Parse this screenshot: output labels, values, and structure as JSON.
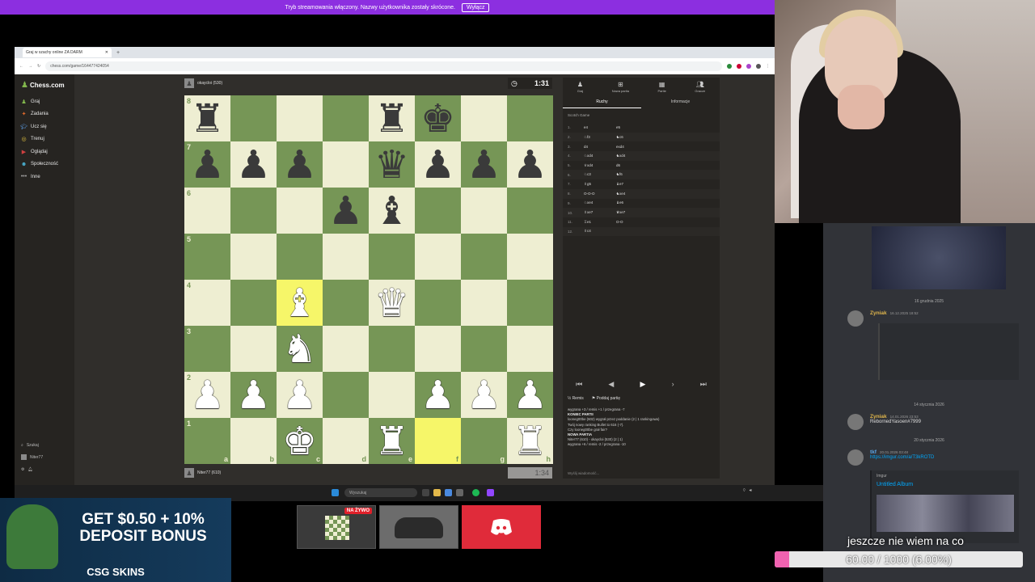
{
  "stream_banner": {
    "text": "Tryb streamowania włączony. Nazwy użytkownika zostały skrócone.",
    "button": "Wyłącz"
  },
  "browser": {
    "tab_title": "Graj w szachy online ZA DARM",
    "url": "chess.com/game/164477424054"
  },
  "sidebar": {
    "logo": "Chess.com",
    "items": [
      {
        "label": "Graj",
        "icon": "pawn-icon"
      },
      {
        "label": "Zadania",
        "icon": "puzzle-icon"
      },
      {
        "label": "Ucz się",
        "icon": "learn-icon"
      },
      {
        "label": "Trenuj",
        "icon": "train-icon"
      },
      {
        "label": "Oglądaj",
        "icon": "watch-icon"
      },
      {
        "label": "Społeczność",
        "icon": "community-icon"
      },
      {
        "label": "Inne",
        "icon": "more-icon"
      }
    ],
    "search_label": "Szukaj",
    "user_label": "Niter77"
  },
  "game": {
    "top_player": "okaycloi (530)",
    "top_clock": "1:31",
    "bottom_player": "Niter77 (610)",
    "bottom_clock": "1:34",
    "files": [
      "a",
      "b",
      "c",
      "d",
      "e",
      "f",
      "g",
      "h"
    ],
    "ranks": [
      "8",
      "7",
      "6",
      "5",
      "4",
      "3",
      "2",
      "1"
    ]
  },
  "board": [
    [
      "r",
      "",
      "",
      "",
      "r",
      "k",
      "",
      ""
    ],
    [
      "p",
      "p",
      "p",
      "",
      "q",
      "p",
      "p",
      "p"
    ],
    [
      "",
      "",
      "",
      "p",
      "b",
      "",
      "",
      ""
    ],
    [
      "",
      "",
      "",
      "",
      "",
      "",
      "",
      ""
    ],
    [
      "",
      "",
      "B",
      "",
      "Q",
      "",
      "",
      ""
    ],
    [
      "",
      "",
      "N",
      "",
      "",
      "",
      "",
      ""
    ],
    [
      "P",
      "P",
      "P",
      "",
      "",
      "P",
      "P",
      "P"
    ],
    [
      "",
      "",
      "K",
      "",
      "R",
      "",
      "",
      "R"
    ]
  ],
  "highlights": [
    "c4",
    "f1"
  ],
  "panel": {
    "tabs": [
      "Graj",
      "Nowa partia",
      "Partie",
      "Gracze"
    ],
    "subtabs": [
      "Ruchy",
      "Informacje"
    ],
    "opening": "Scotch Game",
    "moves": [
      {
        "n": "1.",
        "w": "e4",
        "b": "e5"
      },
      {
        "n": "2.",
        "w": "♘f3",
        "b": "♞c6"
      },
      {
        "n": "3.",
        "w": "d4",
        "b": "exd4"
      },
      {
        "n": "4.",
        "w": "♘xd4",
        "b": "♞xd4"
      },
      {
        "n": "5.",
        "w": "♕xd4",
        "b": "d6"
      },
      {
        "n": "6.",
        "w": "♘c3",
        "b": "♞f6"
      },
      {
        "n": "7.",
        "w": "♗g5",
        "b": "♝e7"
      },
      {
        "n": "8.",
        "w": "O-O-O",
        "b": "♞xe4"
      },
      {
        "n": "9.",
        "w": "♘xe4",
        "b": "♝e6"
      },
      {
        "n": "10.",
        "w": "♗xe7",
        "b": "♛xe7"
      },
      {
        "n": "11.",
        "w": "♖e1",
        "b": "O-O"
      },
      {
        "n": "12.",
        "w": "♗c4",
        "b": ""
      }
    ],
    "actions": [
      "Remis",
      "Poddaj partię"
    ],
    "chat": [
      "wygrana +3 / remis +1 / przegrana -7",
      "KONIEC PARTII",
      "looneg00be (602) wygrał przez poddanie (2 | 1 rankingowa)",
      "Twój nowy ranking Bullet to 616 (-7).",
      "Czy looneg00be grał fair?",
      "NOWA PARTIA",
      "Niter77 (610) - okaycloi (530) (2 | 1)",
      "wygrana +6 / remis -2 / przegrana -10"
    ],
    "input_placeholder": "Wyślij wiadomość..."
  },
  "taskbar": {
    "search": "Wyszukaj"
  },
  "discord": {
    "dates": [
      "16 grudnia 2025",
      "14 stycznia 2026",
      "20 stycznia 2026"
    ],
    "messages": [
      {
        "name": "Zyniak",
        "time": "16.12.2025 18:52",
        "text": ""
      },
      {
        "name": "Zyniak",
        "time": "14.01.2026 23:53",
        "text": "RebornedYasoen#7999"
      },
      {
        "name": "tkf",
        "time": "20.01.2026 03:48",
        "text": "https://imgur.com/a/T3kROTD"
      }
    ],
    "embed_site": "Imgur",
    "embed_title": "Untitled Album"
  },
  "ad": {
    "line1": "GET $0.50 + 10%",
    "line2": "DEPOSIT BONUS",
    "brand": "CSG SKINS"
  },
  "live_badge": "NA ŻYWO",
  "caption": "jeszcze nie wiem na co",
  "goal": {
    "text": "60.00 / 1000 (6.00%)",
    "fraction": 0.06
  }
}
